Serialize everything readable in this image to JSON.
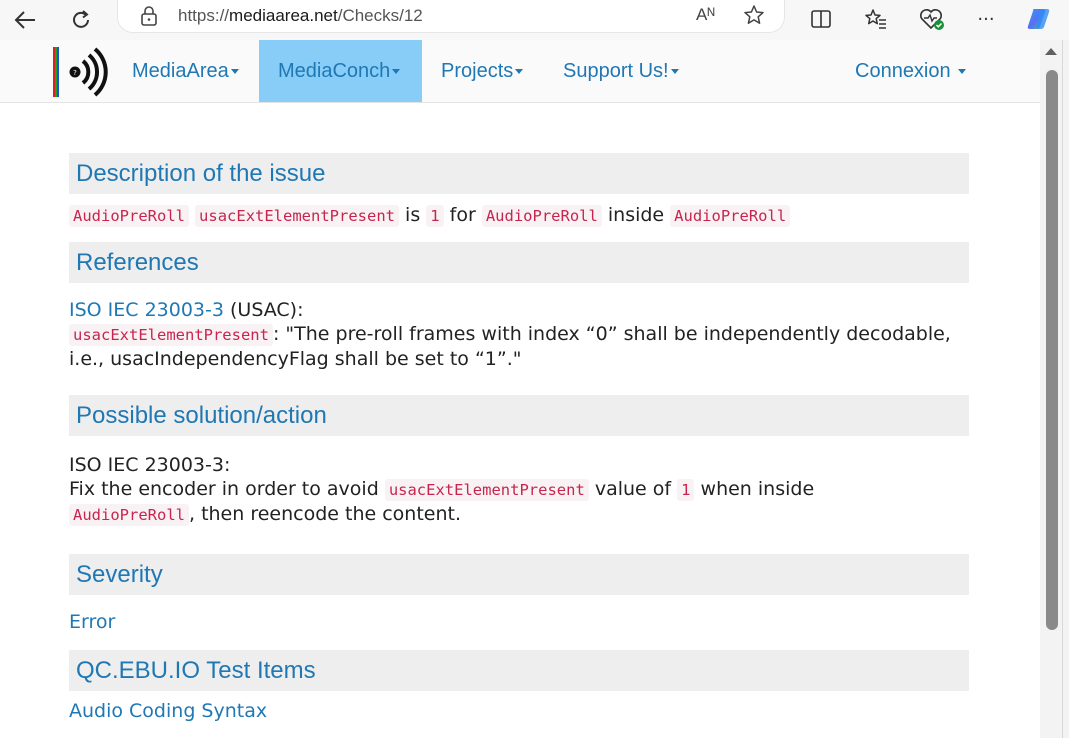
{
  "browser": {
    "url_prefix": "https://",
    "url_host": "mediaarea.net",
    "url_path": "/Checks/12",
    "read_aloud_label": "Aᴺ",
    "more_label": "···"
  },
  "nav": {
    "items": [
      {
        "label": "MediaArea"
      },
      {
        "label": "MediaConch"
      },
      {
        "label": "Projects"
      },
      {
        "label": "Support Us!"
      }
    ],
    "login": "Connexion"
  },
  "description": {
    "heading": "Description of the issue",
    "code1": "AudioPreRoll",
    "code2": "usacExtElementPresent",
    "word_is": "is",
    "code3": "1",
    "word_for": "for",
    "code4": "AudioPreRoll",
    "word_inside": "inside",
    "code5": "AudioPreRoll"
  },
  "references": {
    "heading": "References",
    "link": "ISO IEC 23003-3",
    "suffix": "(USAC):",
    "code": "usacExtElementPresent",
    "quote": ": \"The pre-roll frames with index “0” shall be independently decodable, i.e., usacIndependencyFlag shall be set to “1”.\""
  },
  "solution": {
    "heading": "Possible solution/action",
    "line1": "ISO IEC 23003-3:",
    "pre": "Fix the encoder in order to avoid",
    "code1": "usacExtElementPresent",
    "mid": "value of",
    "code2": "1",
    "post": "when inside",
    "code3": "AudioPreRoll",
    "end": ", then reencode the content."
  },
  "severity": {
    "heading": "Severity",
    "value": "Error"
  },
  "qc": {
    "heading": "QC.EBU.IO Test Items",
    "item": "Audio Coding Syntax"
  },
  "colors": {
    "link": "#1f78b4",
    "active_nav": "#87cdf8",
    "code_text": "#c7254e",
    "code_bg": "#f9f2f4",
    "heading_bg": "#eeeeee"
  }
}
